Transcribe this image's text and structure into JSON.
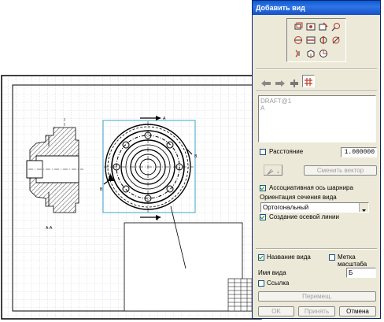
{
  "drawing": {
    "section_label": "A-A",
    "view_label_a_top": "A",
    "view_label_a_bottom": "A",
    "view_label_b_right": "B",
    "view_label_b_left": "B"
  },
  "dialog": {
    "title": "Добавить вид",
    "icon_names": [
      "base-view-icon",
      "projected-view-icon",
      "auxiliary-view-icon",
      "detail-view-icon",
      "section-view-icon",
      "half-section-icon",
      "offset-section-icon",
      "revolved-section-icon",
      "broken-out-section-icon",
      "folded-section-icon",
      "pictorial-view-icon"
    ],
    "list_items": [
      "DRAFT@1",
      "A"
    ],
    "distance_label": "Расстояние",
    "distance_value": "1.000000",
    "change_vector_label": "Сменить вектор",
    "associative_hinge_label": "Ассоциативная ось шарнира",
    "section_orientation_label": "Ориентация сечения вида",
    "orientation_value": "Ортогональный",
    "create_centerline_label": "Создание осевой линии",
    "view_name_checkbox_label": "Название вида",
    "scale_label_checkbox": "Метка масштаба",
    "view_name_label": "Имя вида",
    "view_name_value": "Б",
    "reference_label": "Ссылка",
    "move_button": "Перемещ.",
    "ok_button": "OK",
    "apply_button": "Принять",
    "cancel_button": "Отмена"
  }
}
